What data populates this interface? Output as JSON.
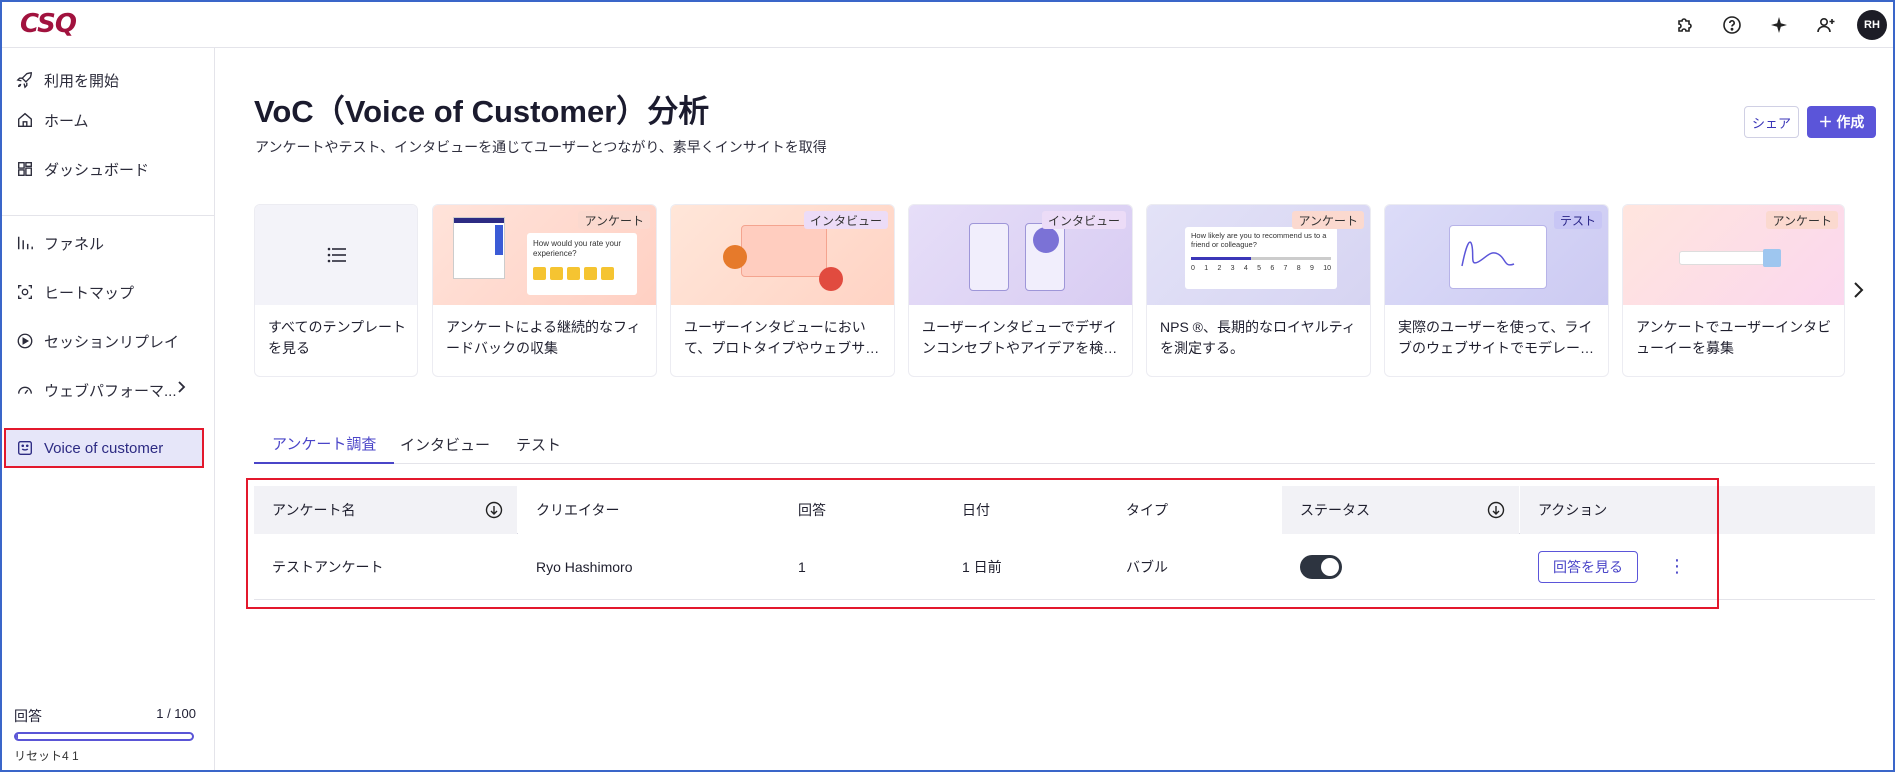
{
  "app": {
    "logo": "CSQ",
    "avatar_initials": "RH",
    "top_icons": [
      "puzzle-icon",
      "help-icon",
      "sparkle-icon",
      "add-user-icon"
    ]
  },
  "sidebar": {
    "items": [
      {
        "label": "利用を開始",
        "icon": "rocket-icon"
      },
      {
        "label": "ホーム",
        "icon": "home-icon"
      },
      {
        "label": "ダッシュボード",
        "icon": "dashboard-icon"
      },
      {
        "label": "ファネル",
        "icon": "funnel-icon"
      },
      {
        "label": "ヒートマップ",
        "icon": "heatmap-icon"
      },
      {
        "label": "セッションリプレイ",
        "icon": "replay-icon"
      },
      {
        "label": "ウェブパフォーマ...",
        "icon": "gauge-icon"
      },
      {
        "label": "Voice of customer",
        "icon": "voc-icon",
        "active": true
      }
    ],
    "quota": {
      "label": "回答",
      "count": "1 / 100",
      "used": 1,
      "limit": 100,
      "reset": "リセット4 1"
    }
  },
  "header": {
    "title": "VoC（Voice of Customer）分析",
    "subtitle": "アンケートやテスト、インタビューを通じてユーザーとつながり、素早くインサイトを取得",
    "share_label": "シェア",
    "create_label": "＋ 作成"
  },
  "templates": [
    {
      "text": "すべてのテンプレートを見る",
      "badge": ""
    },
    {
      "text": "アンケートによる継続的なフィードバックの収集",
      "badge": "アンケート",
      "mock_question": "How would you rate your experience?"
    },
    {
      "text": "ユーザーインタビューにおいて、プロトタイプやウェブサ…",
      "badge": "インタビュー"
    },
    {
      "text": "ユーザーインタビューでデザインコンセプトやアイデアを検…",
      "badge": "インタビュー"
    },
    {
      "text": "NPS ®、長期的なロイヤルティを測定する。",
      "badge": "アンケート",
      "mock_question": "How likely are you to recommend us to a friend or colleague?",
      "scale": [
        "0",
        "1",
        "2",
        "3",
        "4",
        "5",
        "6",
        "7",
        "8",
        "9",
        "10"
      ]
    },
    {
      "text": "実際のユーザーを使って、ライブのウェブサイトでモデレー…",
      "badge": "テスト"
    },
    {
      "text": "アンケートでユーザーインタビューイーを募集",
      "badge": "アンケート"
    }
  ],
  "tabs": [
    {
      "label": "アンケート調査",
      "active": true
    },
    {
      "label": "インタビュー"
    },
    {
      "label": "テスト"
    }
  ],
  "table": {
    "columns": [
      "アンケート名",
      "クリエイター",
      "回答",
      "日付",
      "タイプ",
      "ステータス",
      "アクション"
    ],
    "rows": [
      {
        "name": "テストアンケート",
        "creator": "Ryo Hashimoro",
        "responses": "1",
        "date": "1 日前",
        "type": "バブル",
        "status_on": true,
        "action_label": "回答を見る"
      }
    ]
  },
  "colors": {
    "accent": "#5b55d9",
    "brand": "#a1123e",
    "highlight": "#e3182c"
  }
}
